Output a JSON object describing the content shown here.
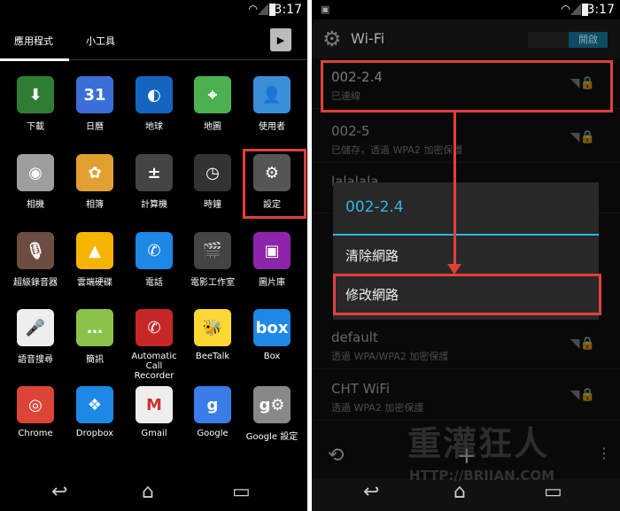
{
  "status": {
    "time": "3:17"
  },
  "launcher": {
    "tabs": [
      "應用程式",
      "小工具"
    ],
    "apps": [
      {
        "label": "下載",
        "color": "#2e7d32",
        "glyph": "⬇"
      },
      {
        "label": "日曆",
        "color": "#3b6fd8",
        "glyph": "31"
      },
      {
        "label": "地球",
        "color": "#1565c0",
        "glyph": "◐"
      },
      {
        "label": "地圖",
        "color": "#4caf50",
        "glyph": "⌖"
      },
      {
        "label": "使用者",
        "color": "#3a8fd8",
        "glyph": "👤"
      },
      {
        "label": "相機",
        "color": "#9e9e9e",
        "glyph": "◉"
      },
      {
        "label": "相簿",
        "color": "#e0a030",
        "glyph": "✿"
      },
      {
        "label": "計算機",
        "color": "#444",
        "glyph": "±"
      },
      {
        "label": "時鐘",
        "color": "#333",
        "glyph": "◷"
      },
      {
        "label": "設定",
        "color": "#555",
        "glyph": "⚙"
      },
      {
        "label": "超級錄音器",
        "color": "#6d4c41",
        "glyph": "🎙"
      },
      {
        "label": "雲端硬碟",
        "color": "#f4b400",
        "glyph": "▲"
      },
      {
        "label": "電話",
        "color": "#1e88e5",
        "glyph": "✆"
      },
      {
        "label": "電影工作室",
        "color": "#444",
        "glyph": "🎬"
      },
      {
        "label": "圖片庫",
        "color": "#8e24aa",
        "glyph": "▣"
      },
      {
        "label": "語音搜尋",
        "color": "#eee",
        "glyph": "🎤"
      },
      {
        "label": "簡訊",
        "color": "#8bc34a",
        "glyph": "…"
      },
      {
        "label": "Automatic Call Recorder",
        "color": "#c62828",
        "glyph": "✆"
      },
      {
        "label": "BeeTalk",
        "color": "#fdd835",
        "glyph": "🐝"
      },
      {
        "label": "Box",
        "color": "#1e88e5",
        "glyph": "box"
      },
      {
        "label": "Chrome",
        "color": "#db4437",
        "glyph": "◎"
      },
      {
        "label": "Dropbox",
        "color": "#1e88e5",
        "glyph": "❖"
      },
      {
        "label": "Gmail",
        "color": "#eee",
        "glyph": "M"
      },
      {
        "label": "Google",
        "color": "#3b7de8",
        "glyph": "g"
      },
      {
        "label": "Google 設定",
        "color": "#888",
        "glyph": "g⚙"
      }
    ]
  },
  "wifi": {
    "title": "Wi-Fi",
    "toggle": "開啟",
    "networks": [
      {
        "name": "002-2.4",
        "status": "已連線"
      },
      {
        "name": "002-5",
        "status": "已儲存，透過 WPA2 加密保護"
      },
      {
        "name": "lalalala",
        "status": ""
      },
      {
        "name": "default",
        "status": "透過 WPA/WPA2 加密保護"
      },
      {
        "name": "CHT WiFi",
        "status": "透過 WPA2 加密保護"
      }
    ],
    "dialog": {
      "title": "002-2.4",
      "items": [
        "清除網路",
        "修改網路"
      ]
    },
    "watermark": "重灌狂人",
    "watermark_url": "HTTP://BRIIAN.COM"
  },
  "colors": {
    "highlight": "#e0403a",
    "accent": "#33b5e5"
  }
}
